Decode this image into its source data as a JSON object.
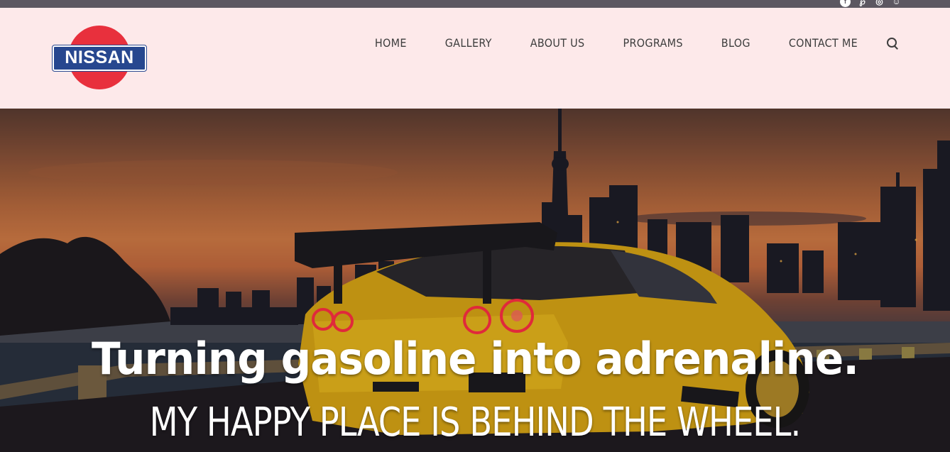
{
  "social": {
    "icons": [
      "facebook-icon",
      "pinterest-icon",
      "instagram-icon",
      "discord-icon"
    ],
    "color": "#ffffff"
  },
  "header": {
    "background": "#fde9ea",
    "logo_text": "NISSAN",
    "logo_colors": {
      "circle": "#e8303d",
      "bar": "#27478f"
    }
  },
  "nav": {
    "items": [
      "HOME",
      "GALLERY",
      "ABOUT US",
      "PROGRAMS",
      "BLOG",
      "CONTACT ME"
    ],
    "search_icon": "search-icon"
  },
  "hero": {
    "title": "Turning gasoline into adrenaline.",
    "subtitle": "MY HAPPY PLACE IS BEHIND THE WHEEL."
  }
}
